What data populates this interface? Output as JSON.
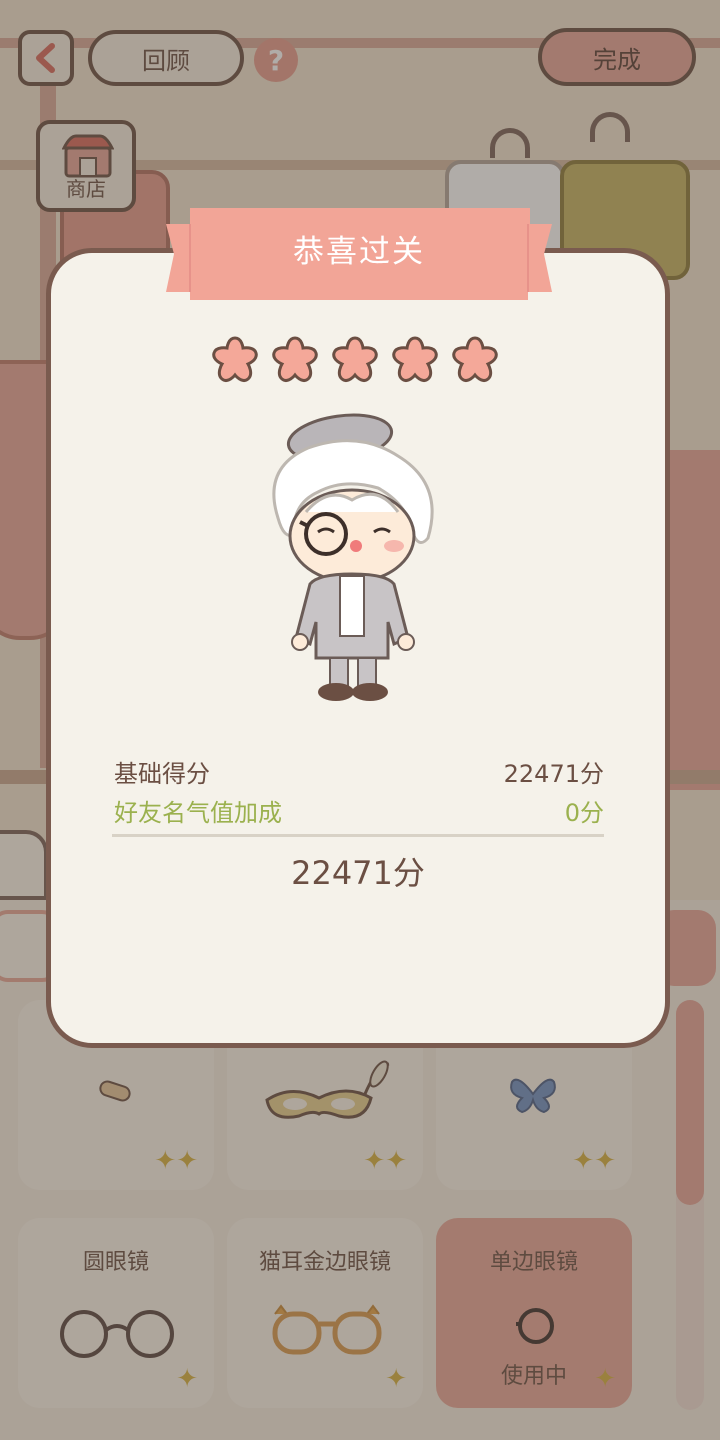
{
  "header": {
    "back_icon": "chevron-left-icon",
    "review_label": "回顾",
    "help_label": "?",
    "done_label": "完成",
    "shop_label": "商店"
  },
  "modal": {
    "title": "恭喜过关",
    "stars_count": 5,
    "base_score_label": "基础得分",
    "base_score_value": "22471分",
    "bonus_label": "好友名气值加成",
    "bonus_value": "0分",
    "total_value": "22471分"
  },
  "items": [
    {
      "label": "",
      "status": ""
    },
    {
      "label": "",
      "status": ""
    },
    {
      "label": "",
      "status": ""
    },
    {
      "label": "圆眼镜",
      "status": ""
    },
    {
      "label": "猫耳金边眼镜",
      "status": ""
    },
    {
      "label": "单边眼镜",
      "status": "使用中"
    }
  ],
  "colors": {
    "accent": "#e7a597",
    "text": "#6b4f43",
    "bonus": "#9bb14e",
    "ribbon": "#f2a597"
  }
}
